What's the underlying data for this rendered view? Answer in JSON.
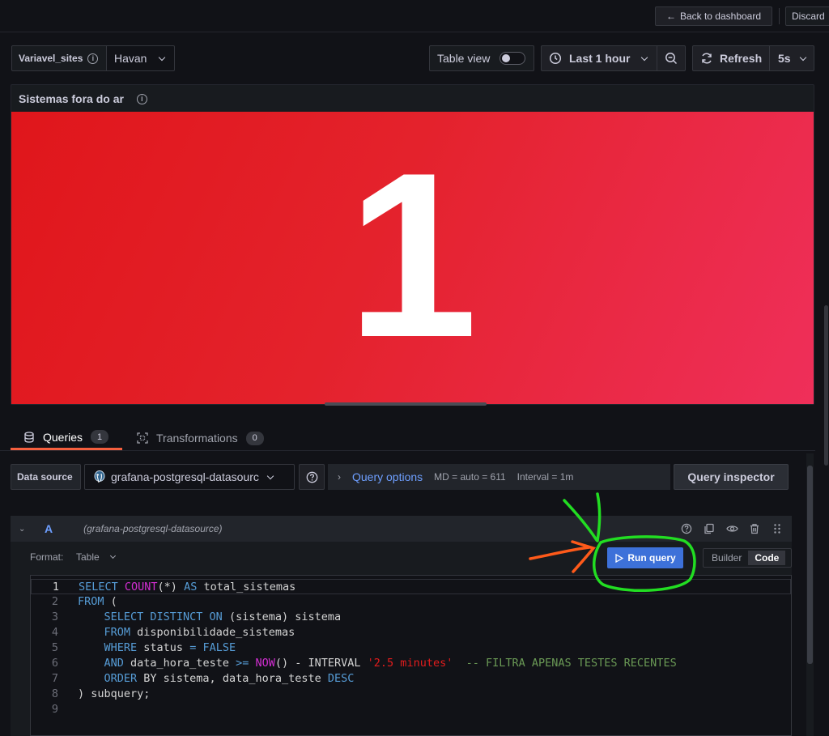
{
  "topbar": {
    "back_label": "Back to dashboard",
    "discard_label": "Discard"
  },
  "variable": {
    "label": "Variavel_sites",
    "value": "Havan"
  },
  "controls": {
    "table_view_label": "Table view",
    "time_range": "Last 1 hour",
    "refresh_label": "Refresh",
    "refresh_interval": "5s"
  },
  "panel": {
    "title": "Sistemas fora do ar",
    "value": "1",
    "bg_color_start": "#e0161b",
    "bg_color_end": "#ef2f5a"
  },
  "tabs": [
    {
      "label": "Queries",
      "count": "1"
    },
    {
      "label": "Transformations",
      "count": "0"
    }
  ],
  "datasource": {
    "label": "Data source",
    "name": "grafana-postgresql-datasourc"
  },
  "query_options": {
    "label": "Query options",
    "md": "MD = auto = 611",
    "interval": "Interval = 1m"
  },
  "query_inspector_label": "Query inspector",
  "query": {
    "ref_id": "A",
    "datasource": "(grafana-postgresql-datasource)",
    "format_label": "Format:",
    "format_value": "Table",
    "run_label": "Run query",
    "modes": [
      "Builder",
      "Code"
    ],
    "active_mode": "Code"
  },
  "editor": {
    "line_numbers": [
      "1",
      "2",
      "3",
      "4",
      "5",
      "6",
      "7",
      "8",
      "9"
    ],
    "lines": [
      [
        [
          "kw",
          "SELECT "
        ],
        [
          "fn",
          "COUNT"
        ],
        [
          "id",
          "(*) "
        ],
        [
          "kw",
          "AS"
        ],
        [
          "id",
          " total_sistemas"
        ]
      ],
      [
        [
          "kw",
          "FROM"
        ],
        [
          "id",
          " ("
        ]
      ],
      [
        [
          "id",
          "    "
        ],
        [
          "kw",
          "SELECT DISTINCT ON"
        ],
        [
          "id",
          " (sistema) sistema"
        ]
      ],
      [
        [
          "id",
          "    "
        ],
        [
          "kw",
          "FROM"
        ],
        [
          "id",
          " disponibilidade_sistemas"
        ]
      ],
      [
        [
          "id",
          "    "
        ],
        [
          "kw",
          "WHERE"
        ],
        [
          "id",
          " status "
        ],
        [
          "kw",
          "="
        ],
        [
          "id",
          " "
        ],
        [
          "kw",
          "FALSE"
        ]
      ],
      [
        [
          "id",
          "    "
        ],
        [
          "kw",
          "AND"
        ],
        [
          "id",
          " data_hora_teste "
        ],
        [
          "kw",
          ">="
        ],
        [
          "id",
          " "
        ],
        [
          "fn",
          "NOW"
        ],
        [
          "id",
          "() - INTERVAL "
        ],
        [
          "str",
          "'2.5 minutes'"
        ],
        [
          "id",
          "  "
        ],
        [
          "cm",
          "-- FILTRA APENAS TESTES RECENTES"
        ]
      ],
      [
        [
          "id",
          "    "
        ],
        [
          "kw",
          "ORDER"
        ],
        [
          "id",
          " BY sistema, data_hora_teste "
        ],
        [
          "kw",
          "DESC"
        ]
      ],
      [
        [
          "id",
          ") subquery;"
        ]
      ],
      [
        [
          "id",
          ""
        ]
      ]
    ]
  },
  "annotation_colors": {
    "green": "#22dd22",
    "orange": "#ff5a1a"
  }
}
